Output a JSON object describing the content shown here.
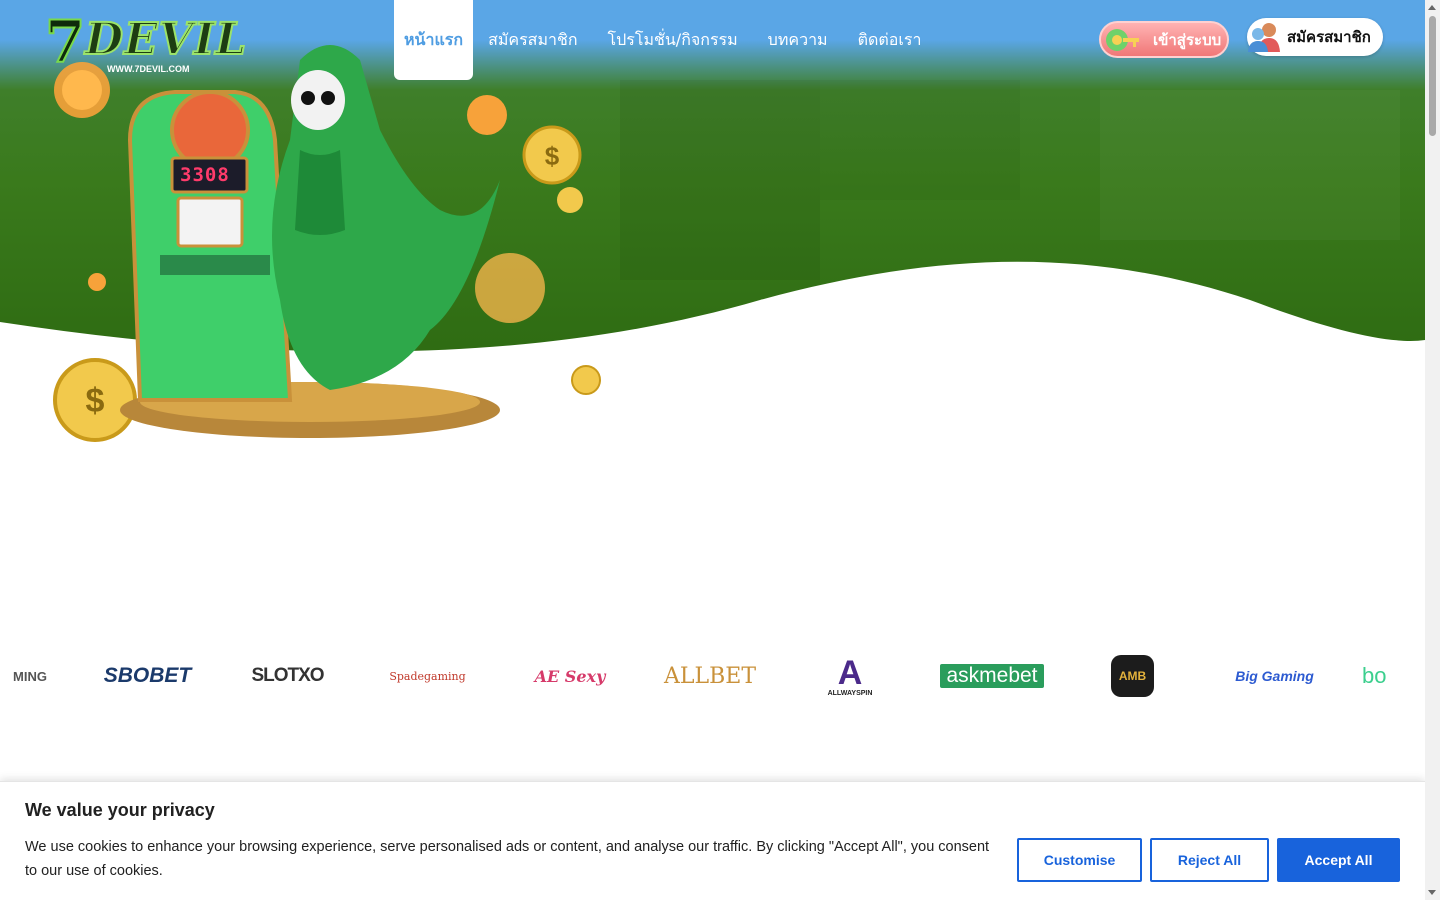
{
  "header": {
    "logo_text": "DEVIL",
    "logo_seven": "7",
    "logo_url": "WWW.7DEVIL.COM",
    "nav": [
      {
        "label": "หน้าแรก",
        "active": true
      },
      {
        "label": "สมัครสมาชิก",
        "active": false
      },
      {
        "label": "โปรโมชั่น/กิจกรรม",
        "active": false
      },
      {
        "label": "บทความ",
        "active": false
      },
      {
        "label": "ติดต่อเรา",
        "active": false
      }
    ],
    "login_label": "เข้าสู่ระบบ",
    "register_label": "สมัครสมาชิก"
  },
  "hero": {
    "slot_display": "3308"
  },
  "partners": [
    {
      "name": "MING",
      "color": "#555555"
    },
    {
      "name": "SBOBET",
      "color": "#1b3a6b"
    },
    {
      "name": "SLOTXO",
      "color": "#333333"
    },
    {
      "name": "Spadegaming",
      "color": "#c0392b"
    },
    {
      "name": "AE Sexy",
      "color": "#d63a6a"
    },
    {
      "name": "ALLBET",
      "color": "#c9913a"
    },
    {
      "name": "ALLWAYSPIN",
      "color": "#4b2a8a"
    },
    {
      "name": "askmebet",
      "color": "#2a9d5c"
    },
    {
      "name": "AMB",
      "color": "#b8860b"
    },
    {
      "name": "Big Gaming",
      "color": "#2d5bd1"
    },
    {
      "name": "bo",
      "color": "#3ccf8e"
    }
  ],
  "cookie": {
    "title": "We value your privacy",
    "text": "We use cookies to enhance your browsing experience, serve personalised ads or content, and analyse our traffic. By clicking \"Accept All\", you consent to our use of cookies.",
    "customise": "Customise",
    "reject": "Reject All",
    "accept": "Accept All"
  },
  "colors": {
    "brand_blue": "#1863dc",
    "sky": "#5aa6e6",
    "grass": "#3a7a1c"
  }
}
